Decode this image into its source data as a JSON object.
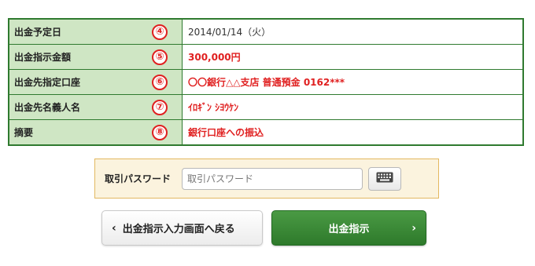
{
  "details": {
    "rows": [
      {
        "label": "出金予定日",
        "num": "④",
        "value": "2014/01/14（火）",
        "highlight": false
      },
      {
        "label": "出金指示金額",
        "num": "⑤",
        "value": "300,000円",
        "highlight": true
      },
      {
        "label": "出金先指定口座",
        "num": "⑥",
        "value": "〇〇銀行△△支店 普通預金 0162***",
        "highlight": true
      },
      {
        "label": "出金先名義人名",
        "num": "⑦",
        "value": "ｲﾛｷﾞﾝ ｼﾖｳｹﾝ",
        "highlight": true
      },
      {
        "label": "摘要",
        "num": "⑧",
        "value": "銀行口座への振込",
        "highlight": true
      }
    ]
  },
  "password": {
    "label": "取引パスワード",
    "placeholder": "取引パスワード",
    "keyboard_icon": "keyboard-icon"
  },
  "buttons": {
    "back_label": "出金指示入力画面へ戻る",
    "submit_label": "出金指示"
  },
  "colors": {
    "accent_green": "#2e7a2b",
    "label_bg": "#cfe6c4",
    "highlight_red": "#e02020"
  }
}
